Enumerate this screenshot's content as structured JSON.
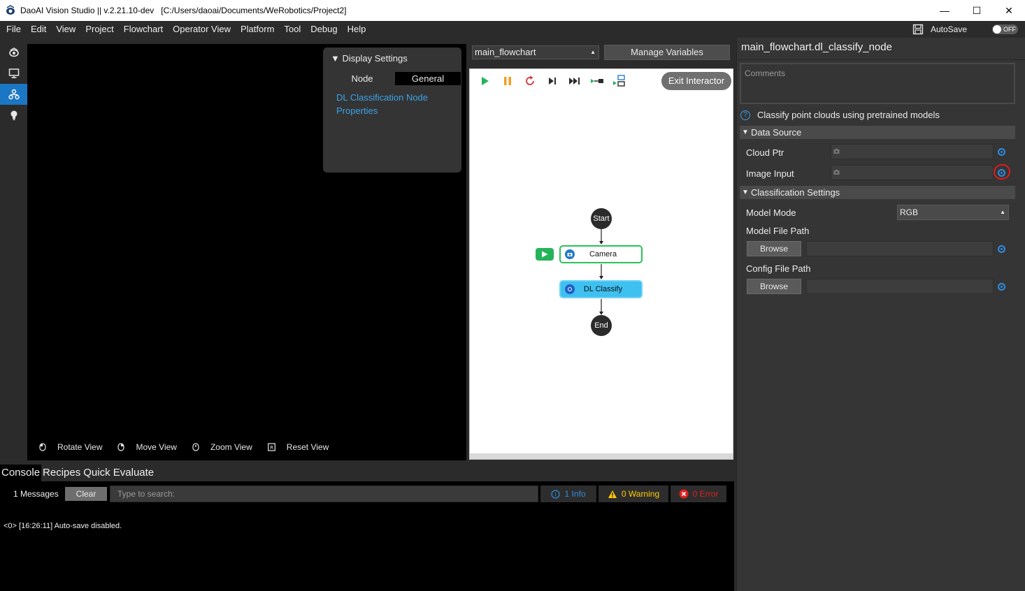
{
  "window": {
    "title": "DaoAI Vision Studio || v.2.21.10-dev   [C:/Users/daoai/Documents/WeRobotics/Project2]",
    "controls": {
      "minimize": "—",
      "maximize": "☐",
      "close": "✕"
    }
  },
  "menubar": {
    "items": [
      "File",
      "Edit",
      "View",
      "Project",
      "Flowchart",
      "Operator View",
      "Platform",
      "Tool",
      "Debug",
      "Help"
    ],
    "autosave_label": "AutoSave",
    "toggle_text": "OFF"
  },
  "sidebar": {
    "items": [
      {
        "icon": "camera-view-icon",
        "active": false
      },
      {
        "icon": "monitor-icon",
        "active": false
      },
      {
        "icon": "flowchart-icon",
        "active": true
      },
      {
        "icon": "lightbulb-icon",
        "active": false
      }
    ]
  },
  "viewport": {
    "display_settings": {
      "header": "Display Settings",
      "tabs": [
        "Node",
        "General"
      ],
      "active_tab": "General",
      "link_text": "DL Classification Node Properties"
    },
    "hints": [
      "Rotate View",
      "Move View",
      "Zoom View",
      "Reset View"
    ]
  },
  "flowchart": {
    "selected": "main_flowchart",
    "manage_label": "Manage Variables",
    "exit_label": "Exit Interactor",
    "nodes": {
      "start": "Start",
      "camera": "Camera",
      "dl": "DL Classify",
      "end": "End"
    },
    "colors": {
      "run": "#25b35a",
      "pause": "#f0a020",
      "restart": "#e03030",
      "camera_border": "#2ac25a",
      "dl_fill": "#3ec0f0"
    }
  },
  "properties": {
    "title": "main_flowchart.dl_classify_node",
    "comments_placeholder": "Comments",
    "description": "Classify point clouds using pretrained models",
    "sections": {
      "data_source": "Data Source",
      "classification": "Classification Settings"
    },
    "fields": {
      "cloud_ptr": "Cloud Ptr",
      "image_input": "Image Input",
      "model_mode": "Model Mode",
      "model_mode_value": "RGB",
      "model_file_path": "Model File Path",
      "config_file_path": "Config File Path",
      "browse": "Browse"
    }
  },
  "console": {
    "tabs": [
      "Console",
      "Recipes",
      "Quick Evaluate"
    ],
    "active_tab": "Console",
    "message_count": "1 Messages",
    "clear": "Clear",
    "search_placeholder": "Type to search:",
    "info": "1 Info",
    "warning": "0 Warning",
    "error": "0 Error",
    "log": "<0> [16:26:11] Auto-save disabled."
  }
}
